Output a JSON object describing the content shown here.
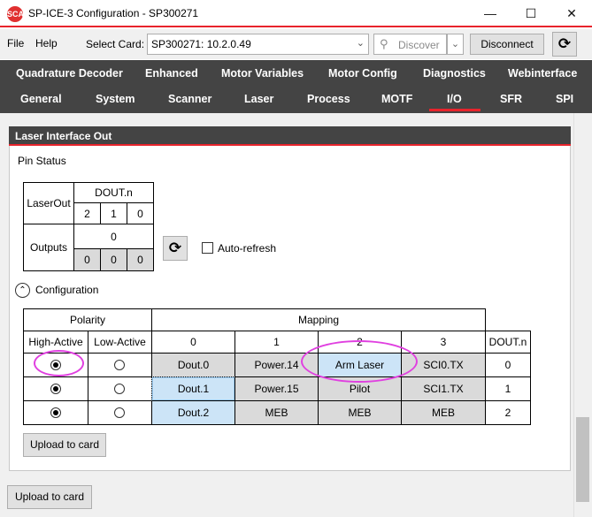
{
  "window": {
    "title": "SP-ICE-3 Configuration - SP300271",
    "icon_text": "SCA"
  },
  "menu": {
    "file": "File",
    "help": "Help",
    "select_card_label": "Select Card:",
    "select_card_value": "SP300271: 10.2.0.49",
    "discover": "Discover",
    "disconnect": "Disconnect"
  },
  "tabs_row1": [
    "Quadrature Decoder",
    "Enhanced",
    "Motor Variables",
    "Motor Config",
    "Diagnostics",
    "Webinterface"
  ],
  "tabs_row2": [
    "General",
    "System",
    "Scanner",
    "Laser",
    "Process",
    "MOTF",
    "I/O",
    "SFR",
    "SPI"
  ],
  "active_tab": "I/O",
  "panel": {
    "title": "Laser Interface Out",
    "pin_status": "Pin Status",
    "pin_table": {
      "laser_out": "LaserOut",
      "dout_n": "DOUT.n",
      "bits": [
        "2",
        "1",
        "0"
      ],
      "outputs": "Outputs",
      "outputs_value": "0",
      "output_bits": [
        "0",
        "0",
        "0"
      ]
    },
    "auto_refresh": "Auto-refresh",
    "configuration": "Configuration",
    "config_table": {
      "polarity": "Polarity",
      "mapping": "Mapping",
      "high_active": "High-Active",
      "low_active": "Low-Active",
      "mapping_cols": [
        "0",
        "1",
        "2",
        "3"
      ],
      "dout_n": "DOUT.n",
      "rows": [
        {
          "high": true,
          "low": false,
          "map": [
            "Dout.0",
            "Power.14",
            "Arm Laser",
            "SCI0.TX"
          ],
          "dout": "0"
        },
        {
          "high": true,
          "low": false,
          "map": [
            "Dout.1",
            "Power.15",
            "Pilot",
            "SCI1.TX"
          ],
          "dout": "1"
        },
        {
          "high": true,
          "low": false,
          "map": [
            "Dout.2",
            "MEB",
            "MEB",
            "MEB"
          ],
          "dout": "2"
        }
      ]
    },
    "upload_inner": "Upload to card"
  },
  "upload_outer": "Upload to card",
  "colors": {
    "accent": "#e8242c",
    "tab_bg": "#444444",
    "highlight": "#cce4f7",
    "annotation": "#e040e0"
  }
}
